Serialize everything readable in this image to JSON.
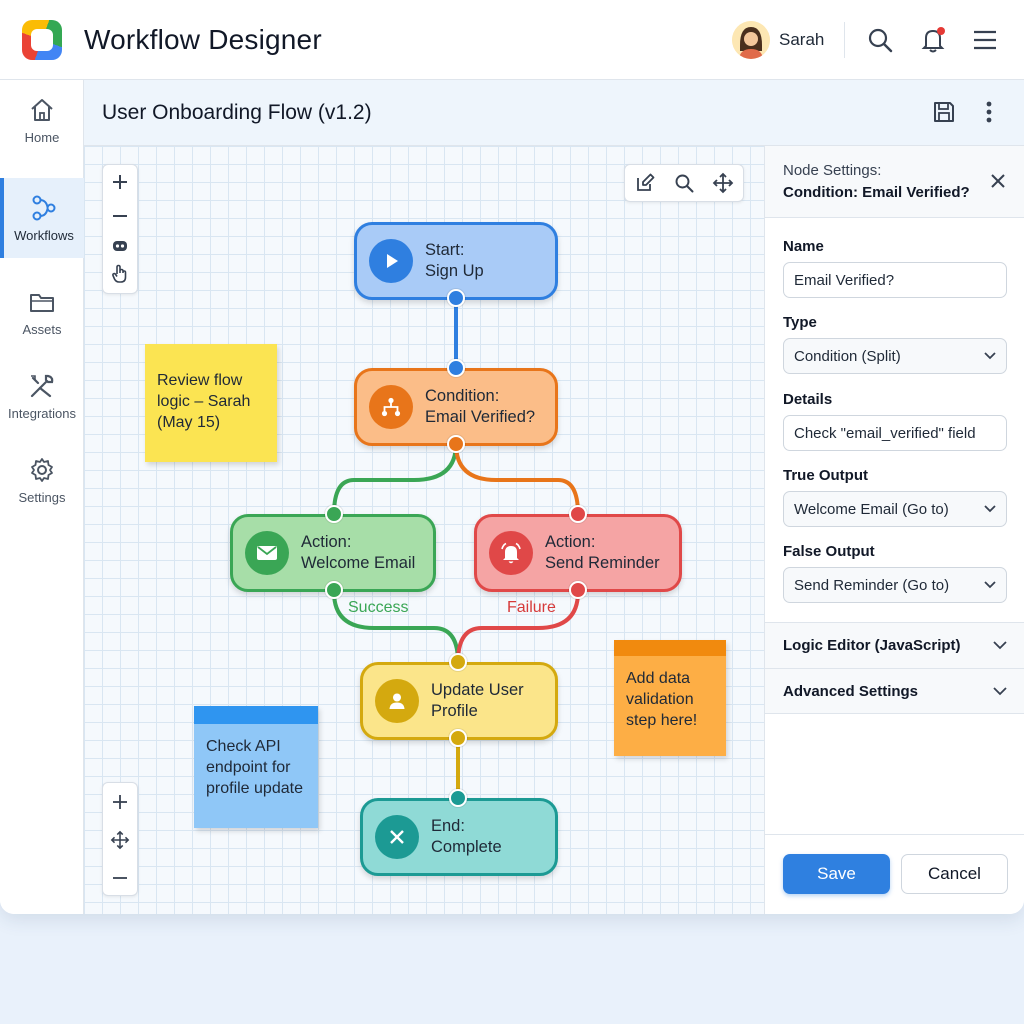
{
  "header": {
    "title": "Workflow Designer",
    "user_name": "Sarah"
  },
  "sidebar": {
    "items": [
      {
        "label": "Home",
        "icon": "home-icon"
      },
      {
        "label": "Workflows",
        "icon": "workflow-icon",
        "active": true
      },
      {
        "label": "Assets",
        "icon": "folder-icon"
      },
      {
        "label": "Integrations",
        "icon": "wrench-icon"
      },
      {
        "label": "Settings",
        "icon": "gear-icon"
      }
    ]
  },
  "canvas": {
    "flow_title": "User Onboarding Flow (v1.2)",
    "nodes": {
      "start": {
        "line1": "Start:",
        "line2": "Sign Up",
        "color": "#2f7fe0"
      },
      "condition": {
        "line1": "Condition:",
        "line2": "Email Verified?",
        "color": "#e8751a"
      },
      "welcome": {
        "line1": "Action:",
        "line2": "Welcome Email",
        "color": "#3aa655"
      },
      "reminder": {
        "line1": "Action:",
        "line2": "Send Reminder",
        "color": "#e04848"
      },
      "update": {
        "line1": "Update User",
        "line2": "Profile",
        "color": "#d4a90f"
      },
      "end": {
        "line1": "End:",
        "line2": "Complete",
        "color": "#1c9a94"
      }
    },
    "edge_labels": {
      "success": "Success",
      "failure": "Failure"
    },
    "sticky_notes": {
      "yellow": {
        "line1": "Review flow",
        "line2": "logic – Sarah",
        "line3": "(May 15)"
      },
      "blue": {
        "line1": "Check API",
        "line2": "endpoint for",
        "line3": "profile update"
      },
      "orange": {
        "line1": "Add data",
        "line2": "validation",
        "line3": "step here!"
      }
    }
  },
  "panel": {
    "title_prefix": "Node Settings:",
    "title_node": "Condition: Email Verified?",
    "fields": {
      "name": {
        "label": "Name",
        "value": "Email Verified?"
      },
      "type": {
        "label": "Type",
        "value": "Condition (Split)"
      },
      "details": {
        "label": "Details",
        "value": "Check \"email_verified\" field"
      },
      "true_output": {
        "label": "True Output",
        "value": "Welcome Email (Go to)"
      },
      "false_output": {
        "label": "False Output",
        "value": "Send Reminder (Go to)"
      }
    },
    "sections": {
      "logic": "Logic Editor (JavaScript)",
      "advanced": "Advanced Settings"
    },
    "buttons": {
      "save": "Save",
      "cancel": "Cancel"
    }
  }
}
